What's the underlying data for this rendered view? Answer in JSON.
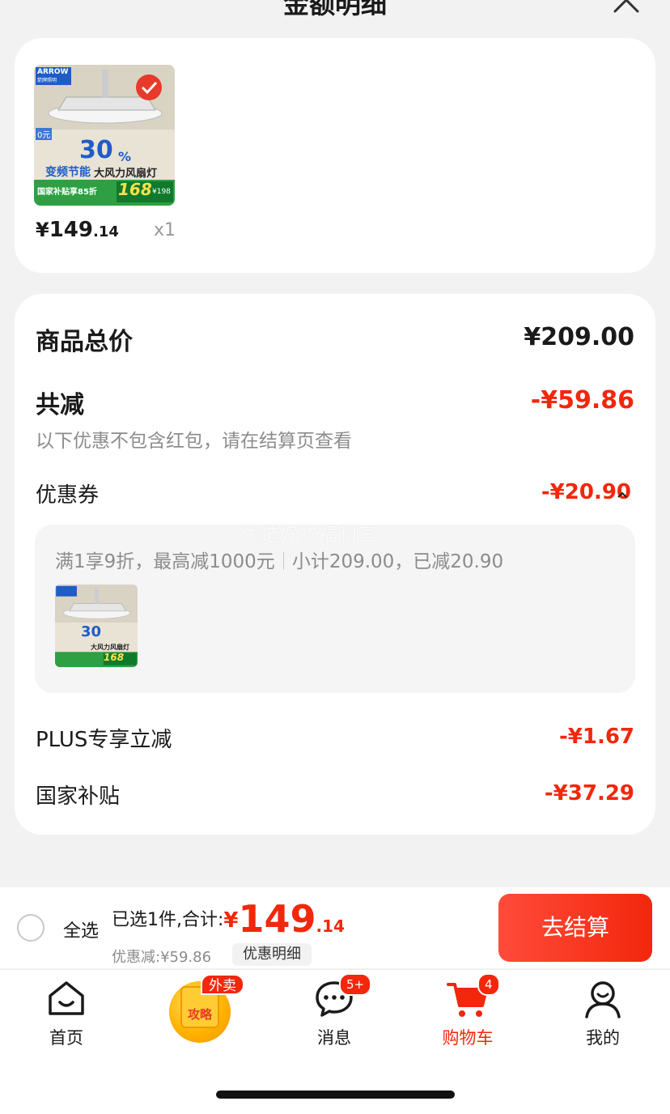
{
  "header": {
    "title": "金额明细"
  },
  "product": {
    "brand": "ARROW",
    "brand_sub": "箭牌照明",
    "image_texts": {
      "percent": "30",
      "percent_unit": "%",
      "promo_zero": "0元",
      "headline_a": "变频节能",
      "headline_b": "大风力风扇灯",
      "subsidy": "国家补贴享85折",
      "price_big": "168",
      "price_small": "¥198"
    },
    "price_yen": "¥",
    "price_int": "149",
    "price_dec": ".14",
    "qty": "x1"
  },
  "detail": {
    "total_label": "商品总价",
    "total_value": "¥209.00",
    "reduce_label": "共减",
    "reduce_value": "-¥59.86",
    "note": "以下优惠不包含红包，请在结算页查看",
    "coupon_label": "优惠券",
    "coupon_value": "-¥20.90",
    "coupon_rule": "满1享9折，最高减1000元",
    "coupon_subtotal": "小计209.00，已减20.90",
    "watermark": "优选好物福利官",
    "plus_label": "PLUS专享立减",
    "plus_value": "-¥1.67",
    "gov_label": "国家补贴",
    "gov_value": "-¥37.29"
  },
  "checkout": {
    "select_all": "全选",
    "selected_text": "已选1件,合计:",
    "total_yen": "¥",
    "total_int": "149",
    "total_dec": ".14",
    "discount_text": "优惠减:¥59.86",
    "detail_chip": "优惠明细",
    "checkout_button": "去结算"
  },
  "tabbar": {
    "home": "首页",
    "promo_badge": "外卖",
    "promo_text": "攻略",
    "messages": "消息",
    "messages_badge": "5+",
    "cart": "购物车",
    "cart_badge": "4",
    "me": "我的"
  },
  "colors": {
    "accent": "#f2270c",
    "background": "#f2f2f2"
  }
}
